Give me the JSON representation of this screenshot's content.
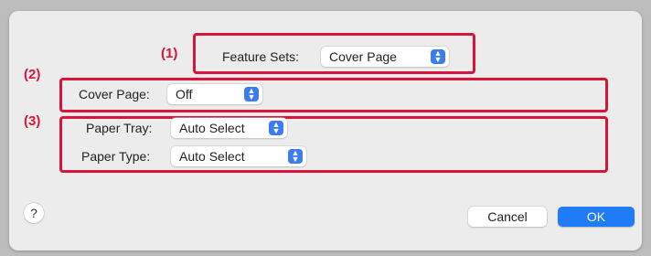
{
  "callouts": {
    "c1": "(1)",
    "c2": "(2)",
    "c3": "(3)"
  },
  "feature_sets": {
    "label": "Feature Sets:",
    "value": "Cover Page"
  },
  "cover_page": {
    "label": "Cover Page:",
    "value": "Off"
  },
  "paper_tray": {
    "label": "Paper Tray:",
    "value": "Auto Select"
  },
  "paper_type": {
    "label": "Paper Type:",
    "value": "Auto Select"
  },
  "buttons": {
    "help": "?",
    "cancel": "Cancel",
    "ok": "OK"
  },
  "icons": {
    "popup_arrows": "updown-chevron-icon",
    "help": "help-icon"
  },
  "colors": {
    "highlight": "#d9143a",
    "accent": "#1f7cf5"
  }
}
